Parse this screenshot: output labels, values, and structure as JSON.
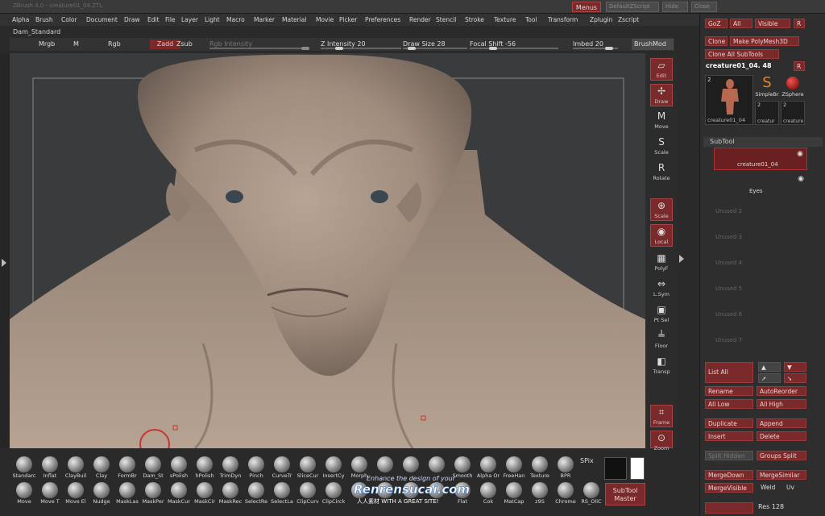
{
  "window": {
    "title": "ZBrush 4.0 - creature01_04.ZTL",
    "menus_button": "Menus",
    "right_buttons": [
      "DefaultZScript",
      "Hide",
      "Close"
    ]
  },
  "menubar": [
    "Alpha",
    "Brush",
    "Color",
    "Document",
    "Draw",
    "Edit",
    "File",
    "Layer",
    "Light",
    "Macro",
    "Marker",
    "Material",
    "Movie",
    "Picker",
    "Preferences",
    "Render",
    "Stencil",
    "Stroke",
    "Texture",
    "Tool",
    "Transform",
    "Zplugin",
    "Zscript"
  ],
  "brush_name": "Dam_Standard",
  "toolbar": {
    "mrgb": "Mrgb",
    "m": "M",
    "rgb": "Rgb",
    "zadd": "Zadd",
    "zsub": "Zsub",
    "rgb_intensity": "Rgb Intensity",
    "z_intensity": "Z Intensity 20",
    "draw_size": "Draw Size 28",
    "focal_shift": "Focal Shift -56",
    "imbed": "Imbed 20",
    "brushmod": "BrushMod"
  },
  "right_tools": [
    {
      "icon": "edit-icon",
      "glyph": "▱",
      "label": "Edit",
      "active": true
    },
    {
      "icon": "draw-icon",
      "glyph": "✢",
      "label": "Draw",
      "active": true
    },
    {
      "icon": "move-icon",
      "glyph": "M",
      "label": "Move",
      "active": false
    },
    {
      "icon": "scale-icon",
      "glyph": "S",
      "label": "Scale",
      "active": false
    },
    {
      "icon": "rotate-icon",
      "glyph": "R",
      "label": "Rotate",
      "active": false
    },
    {
      "icon": "zoom-scale-icon",
      "glyph": "⊕",
      "label": "Scale",
      "active": true
    },
    {
      "icon": "local-icon",
      "glyph": "◉",
      "label": "Local",
      "active": true
    },
    {
      "icon": "polyf-icon",
      "glyph": "▦",
      "label": "PolyF",
      "active": false
    },
    {
      "icon": "lsym-icon",
      "glyph": "⇔",
      "label": "L.Sym",
      "active": false
    },
    {
      "icon": "ptsel-icon",
      "glyph": "▣",
      "label": "Pt Sel",
      "active": false
    },
    {
      "icon": "floor-icon",
      "glyph": "╧",
      "label": "Floor",
      "active": false
    },
    {
      "icon": "transp-icon",
      "glyph": "◧",
      "label": "Transp",
      "active": false
    },
    {
      "icon": "frame-icon",
      "glyph": "⌗",
      "label": "Frame",
      "active": true
    },
    {
      "icon": "zoom-icon",
      "glyph": "⊙",
      "label": "Zoom",
      "active": true
    },
    {
      "icon": "actual-icon",
      "glyph": "⊡",
      "label": "Actual",
      "active": true
    },
    {
      "icon": "aahalf-icon",
      "glyph": "⊠",
      "label": "AAHalf",
      "active": true
    }
  ],
  "panel": {
    "goz": "GoZ",
    "all": "All",
    "visible": "Visible",
    "r": "R",
    "clone": "Clone",
    "make_polymesh": "Make PolyMesh3D",
    "clone_all": "Clone All SubTools",
    "tool_name": "creature01_04. 48",
    "tool_r": "R",
    "thumb_count": "2",
    "thumb_label": "creature01_04",
    "small_tools": [
      {
        "name": "SimpleBr",
        "count": ""
      },
      {
        "name": "ZSphere",
        "count": ""
      },
      {
        "name": "creatur",
        "count": "2"
      },
      {
        "name": "creature",
        "count": "2"
      }
    ],
    "subtool_title": "SubTool",
    "subtools": [
      {
        "name": "creature01_04",
        "selected": true
      },
      {
        "name": "Eyes",
        "selected": false
      }
    ],
    "unused": [
      "Unused 2",
      "Unused 3",
      "Unused 4",
      "Unused 5",
      "Unused 6",
      "Unused 7"
    ],
    "list_all": "List All",
    "rename": "Rename",
    "autoreorder": "AutoReorder",
    "all_low": "All Low",
    "all_high": "All High",
    "duplicate": "Duplicate",
    "append": "Append",
    "insert": "Insert",
    "delete": "Delete",
    "split_hidden": "Split Hidden",
    "groups_split": "Groups Split",
    "merge_down": "MergeDown",
    "merge_similar": "MergeSimilar",
    "merge_visible": "MergeVisible",
    "weld": "Weld",
    "uv": "Uv",
    "res": "Res 128"
  },
  "shelf_top": [
    "Standarc",
    "Inflat",
    "ClayBuil",
    "Clay",
    "FormBr",
    "Dam_St",
    "sPolish",
    "hPolish",
    "TrimDyn",
    "Pinch",
    "CurveTr",
    "SliceCur",
    "InsertCy",
    "Morph",
    "",
    "",
    "",
    "Smooth",
    "Alpha Or",
    "FreeHan",
    "Texture",
    "BPR"
  ],
  "shelf_bottom": [
    "Move",
    "Move T",
    "Move El",
    "Nudge",
    "MaskLas",
    "MaskPer",
    "MaskCur",
    "MaskCir",
    "MaskRec",
    "SelectRe",
    "SelectLa",
    "ClipCurv",
    "ClipCirck",
    "",
    "",
    "",
    "",
    "Flat",
    "Cok",
    "MatCap",
    "z9S",
    "Chrome",
    "RS_OliC"
  ],
  "spix": "SPix",
  "subtool_master": "SubTool Master",
  "watermark": {
    "line1": "Enhance the design of your",
    "line2": "Renrensucai.com",
    "line3": "人人素材  WITH A GREAT SITE!"
  }
}
